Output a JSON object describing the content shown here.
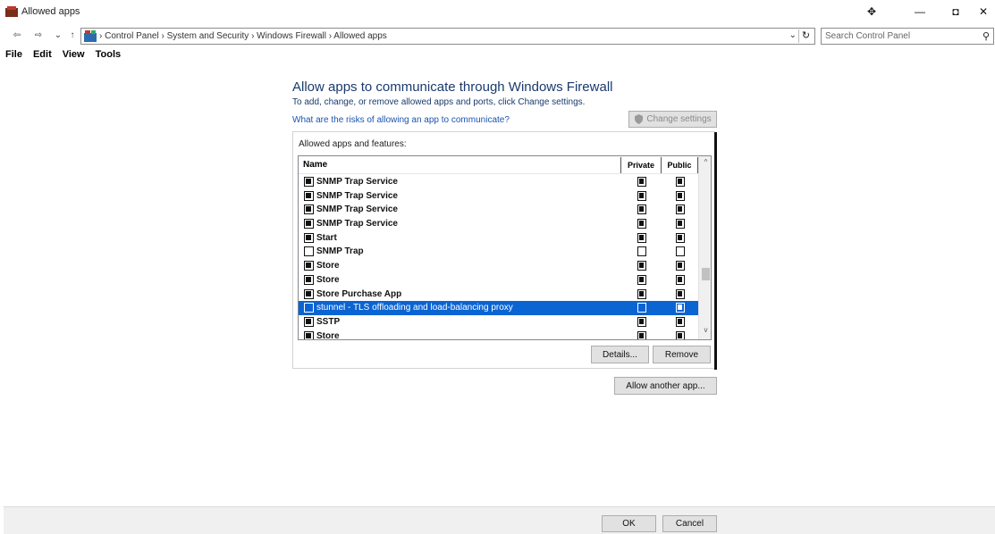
{
  "window": {
    "title": "Allowed apps",
    "controls": {
      "pin": "✥",
      "minimize": "—",
      "maximize": "◘",
      "close": "✕"
    }
  },
  "nav": {
    "back": "⇦",
    "forward": "⇨",
    "recent": "⌄",
    "up": "↑",
    "breadcrumb": "› Control Panel › System and Security › Windows Firewall › Allowed apps",
    "dropdown": "⌄",
    "refresh": "↻",
    "search_placeholder": "Search Control Panel",
    "search_icon": "⚲"
  },
  "menu": [
    "File",
    "Edit",
    "View",
    "Tools"
  ],
  "main": {
    "heading": "Allow apps to communicate through Windows Firewall",
    "subheading": "To add, change, or remove allowed apps and ports, click Change settings.",
    "risk_link": "What are the risks of allowing an app to communicate?",
    "change_settings": "Change settings",
    "group_label": "Allowed apps and features:",
    "columns": {
      "name": "Name",
      "private": "Private",
      "public": "Public"
    },
    "apps": [
      {
        "name": "SNMP Trap Service",
        "enabled": true,
        "private": true,
        "public": true
      },
      {
        "name": "SNMP Trap Service",
        "enabled": true,
        "private": true,
        "public": true
      },
      {
        "name": "SNMP Trap Service",
        "enabled": true,
        "private": true,
        "public": true
      },
      {
        "name": "SNMP Trap Service",
        "enabled": true,
        "private": true,
        "public": true
      },
      {
        "name": "Start",
        "enabled": true,
        "private": true,
        "public": true
      },
      {
        "name": "SNMP Trap",
        "enabled": false,
        "private": false,
        "public": false
      },
      {
        "name": "Store",
        "enabled": true,
        "private": true,
        "public": true
      },
      {
        "name": "Store",
        "enabled": true,
        "private": true,
        "public": true
      },
      {
        "name": "Store Purchase App",
        "enabled": true,
        "private": true,
        "public": true
      },
      {
        "name": "stunnel - TLS offloading and load-balancing proxy",
        "enabled": false,
        "private": false,
        "public": true,
        "selected": true
      },
      {
        "name": "SSTP",
        "enabled": true,
        "private": true,
        "public": true
      },
      {
        "name": "Store",
        "enabled": true,
        "private": true,
        "public": true
      }
    ],
    "details": "Details...",
    "remove": "Remove",
    "allow_another": "Allow another app..."
  },
  "footer": {
    "ok": "OK",
    "cancel": "Cancel"
  },
  "scroll": {
    "up": "^",
    "down": "v"
  }
}
